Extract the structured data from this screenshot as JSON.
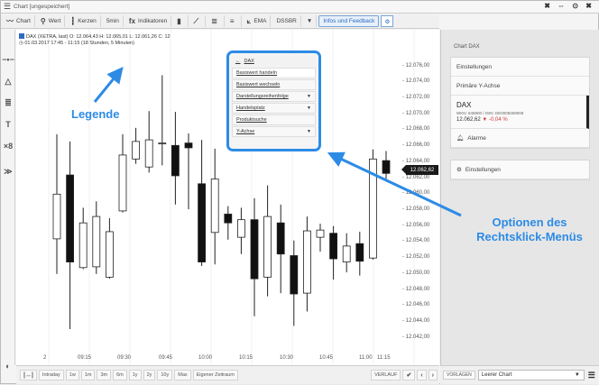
{
  "window": {
    "title": "Chart [ungespeichert]",
    "controls": "✖ ⇔ ⊙ ✖"
  },
  "toolbar": {
    "chart": "Chart",
    "wert": "Wert",
    "kerzen": "Kerzen",
    "interval": "5min",
    "indikatoren": "Indikatoren",
    "ema": "EMA",
    "dssbr": "DSSBR",
    "info": "Infos und Feedback"
  },
  "legend": {
    "line1": "DAX (XETRA, last)  O: 12.064,43  H: 12.065,01  L: 12.061,26  C: 12",
    "line2": "01.03.2017 17:45 - 11:15  (18 Stunden, 5 Minuten)"
  },
  "context_menu": {
    "title": "DAX",
    "items": [
      {
        "label": "Basiswert handeln",
        "arrow": ""
      },
      {
        "label": "Basiswert wechseln",
        "arrow": ""
      },
      {
        "label": "Darstellungsreihenfolge",
        "arrow": "▼"
      },
      {
        "label": "Handelsplatz",
        "arrow": "▼"
      },
      {
        "label": "Produktsuche",
        "arrow": ""
      },
      {
        "label": "Y-Achse",
        "arrow": "▼"
      }
    ]
  },
  "price_axis": [
    "12.076,00",
    "12.074,00",
    "12.072,00",
    "12.070,00",
    "12.068,00",
    "12.066,00",
    "12.064,00",
    "12.062,00",
    "12.060,00",
    "12.058,00",
    "12.056,00",
    "12.054,00",
    "12.052,00",
    "12.050,00",
    "12.048,00",
    "12.046,00",
    "12.044,00",
    "12.042,00"
  ],
  "current_price": "12.062,62",
  "time_axis": [
    "2",
    "09:15",
    "09:30",
    "09:45",
    "10:00",
    "10:15",
    "10:30",
    "10:45",
    "11:00",
    "11:15"
  ],
  "bottom_bar": {
    "ranges": [
      "Intraday",
      "1w",
      "1m",
      "3m",
      "6m",
      "1y",
      "2y",
      "10y",
      "Max",
      "Eigener Zeitraum"
    ],
    "verlauf": "VERLAUF"
  },
  "panel": {
    "section": "Chart DAX",
    "items": [
      "Einstellungen",
      "Primäre Y-Achse"
    ],
    "instrument": {
      "name": "DAX",
      "ids": "WKN: 846900 / ISIN: DE0008469008",
      "price": "12.062,62",
      "change": "-0,04 %"
    },
    "alarme": "Alarme",
    "settings": "Einstellungen",
    "vorlagen": "VORLAGEN",
    "template": "Leerer Chart"
  },
  "annotations": {
    "legend": "Legende",
    "options": "Optionen des Rechtsklick-Menüs"
  },
  "colors": {
    "accent": "#2d8be6",
    "negative": "#d23b3b"
  },
  "chart_data": {
    "type": "candlestick",
    "interval": "5min",
    "x": [
      "09:15",
      "09:30",
      "09:45",
      "10:00",
      "10:15",
      "10:30",
      "10:45",
      "11:00",
      "11:15"
    ],
    "candles": [
      {
        "o": 12054.4,
        "c": 12060.0,
        "h": 12067.5,
        "l": 12050.0,
        "dir": "up"
      },
      {
        "o": 12062.4,
        "c": 12051.5,
        "h": 12066.6,
        "l": 12043.1,
        "dir": "down"
      },
      {
        "o": 12050.8,
        "c": 12056.4,
        "h": 12058.3,
        "l": 12050.6,
        "dir": "up"
      },
      {
        "o": 12050.9,
        "c": 12057.2,
        "h": 12059.1,
        "l": 12050.0,
        "dir": "up"
      },
      {
        "o": 12049.6,
        "c": 12055.3,
        "h": 12057.0,
        "l": 12049.4,
        "dir": "up"
      },
      {
        "o": 12057.9,
        "c": 12064.9,
        "h": 12067.5,
        "l": 12057.7,
        "dir": "up"
      },
      {
        "o": 12064.4,
        "c": 12066.6,
        "h": 12068.3,
        "l": 12063.8,
        "dir": "up"
      },
      {
        "o": 12063.4,
        "c": 12066.8,
        "h": 12070.4,
        "l": 12062.7,
        "dir": "up"
      },
      {
        "o": 12066.4,
        "c": 12066.4,
        "h": 12074.9,
        "l": 12063.6,
        "dir": "up"
      },
      {
        "o": 12066.1,
        "c": 12062.3,
        "h": 12070.3,
        "l": 12058.7,
        "dir": "down"
      },
      {
        "o": 12066.4,
        "c": 12065.8,
        "h": 12067.6,
        "l": 12058.1,
        "dir": "down"
      },
      {
        "o": 12061.3,
        "c": 12051.5,
        "h": 12066.8,
        "l": 12051.0,
        "dir": "down"
      },
      {
        "o": 12055.2,
        "c": 12061.9,
        "h": 12065.7,
        "l": 12051.2,
        "dir": "up"
      },
      {
        "o": 12057.5,
        "c": 12056.4,
        "h": 12058.5,
        "l": 12054.3,
        "dir": "down"
      },
      {
        "o": 12054.6,
        "c": 12056.8,
        "h": 12058.3,
        "l": 12052.5,
        "dir": "up"
      },
      {
        "o": 12056.8,
        "c": 12049.4,
        "h": 12059.5,
        "l": 12044.7,
        "dir": "down"
      },
      {
        "o": 12049.6,
        "c": 12057.2,
        "h": 12061.1,
        "l": 12047.2,
        "dir": "up"
      },
      {
        "o": 12056.4,
        "c": 12052.5,
        "h": 12058.7,
        "l": 12047.6,
        "dir": "down"
      },
      {
        "o": 12052.3,
        "c": 12047.5,
        "h": 12054.2,
        "l": 12043.5,
        "dir": "down"
      },
      {
        "o": 12047.6,
        "c": 12055.4,
        "h": 12057.2,
        "l": 12045.3,
        "dir": "up"
      },
      {
        "o": 12054.6,
        "c": 12055.5,
        "h": 12056.3,
        "l": 12052.8,
        "dir": "up"
      },
      {
        "o": 12055.1,
        "c": 12051.9,
        "h": 12056.0,
        "l": 12049.3,
        "dir": "down"
      },
      {
        "o": 12051.5,
        "c": 12053.5,
        "h": 12055.1,
        "l": 12050.2,
        "dir": "up"
      },
      {
        "o": 12053.8,
        "c": 12051.6,
        "h": 12055.3,
        "l": 12049.8,
        "dir": "down"
      },
      {
        "o": 12052.0,
        "c": 12064.4,
        "h": 12065.6,
        "l": 12051.8,
        "dir": "up"
      },
      {
        "o": 12064.2,
        "c": 12062.6,
        "h": 12065.4,
        "l": 12061.8,
        "dir": "down"
      }
    ],
    "ylim": [
      12040.5,
      12077.2
    ]
  }
}
